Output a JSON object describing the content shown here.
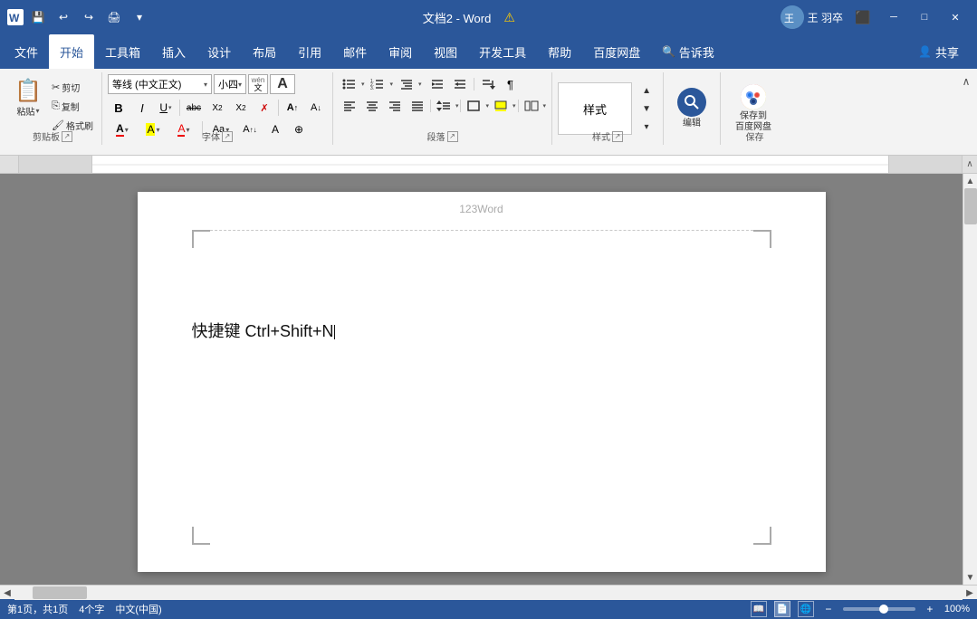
{
  "titleBar": {
    "title": "文档2 - Word",
    "appName": "Word",
    "docName": "文档2",
    "user": "王 羽卒",
    "warning": "⚠",
    "quickAccess": [
      "💾",
      "↩",
      "↪",
      "🖨",
      "≡"
    ]
  },
  "menuBar": {
    "items": [
      "文件",
      "开始",
      "工具箱",
      "插入",
      "设计",
      "布局",
      "引用",
      "邮件",
      "审阅",
      "视图",
      "开发工具",
      "帮助",
      "百度网盘",
      "告诉我"
    ],
    "active": "开始"
  },
  "ribbon": {
    "groups": {
      "clipboard": {
        "label": "剪贴板",
        "paste": "粘贴",
        "cut": "✂",
        "copy": "⎘",
        "formatPainter": "🖌"
      },
      "font": {
        "label": "字体",
        "fontName": "等线 (中文正文)",
        "fontSize": "小四",
        "wen": "wén",
        "A_large": "A",
        "bold": "B",
        "italic": "I",
        "underline": "U",
        "strikethrough": "abc",
        "subscript": "X₂",
        "superscript": "X²",
        "clearFormat": "✗",
        "fontColor": "A",
        "highlight": "A",
        "shadingColor": "A",
        "Aa": "Aa",
        "sizeUp": "A↑",
        "sizeDown": "A↓",
        "special": "A⊕"
      },
      "paragraph": {
        "label": "段落",
        "listBullet": "≡",
        "listNumber": "≡",
        "listMulti": "≡",
        "indent_decrease": "⇤",
        "indent_increase": "⇥",
        "align_left": "≡",
        "align_center": "≡",
        "align_right": "≡",
        "justify": "≡",
        "line_spacing": "↕",
        "sort": "↕",
        "show_marks": "¶",
        "border": "□",
        "shading": "▭",
        "columns": "⋮⋮"
      },
      "styles": {
        "label": "样式",
        "normal": "样式"
      },
      "editing": {
        "label": "编辑",
        "icon": "🔍"
      },
      "save": {
        "label": "保存",
        "saveToCloud": "保存到\n百度网盘"
      }
    }
  },
  "document": {
    "headerText": "123Word",
    "bodyText": "快捷键 Ctrl+Shift+N",
    "cursorVisible": true
  },
  "statusBar": {
    "pages": "第1页，共1页",
    "words": "4个字",
    "language": "中文(中国)",
    "zoom": "100%",
    "viewModes": [
      "阅读",
      "页面",
      "Web"
    ]
  }
}
